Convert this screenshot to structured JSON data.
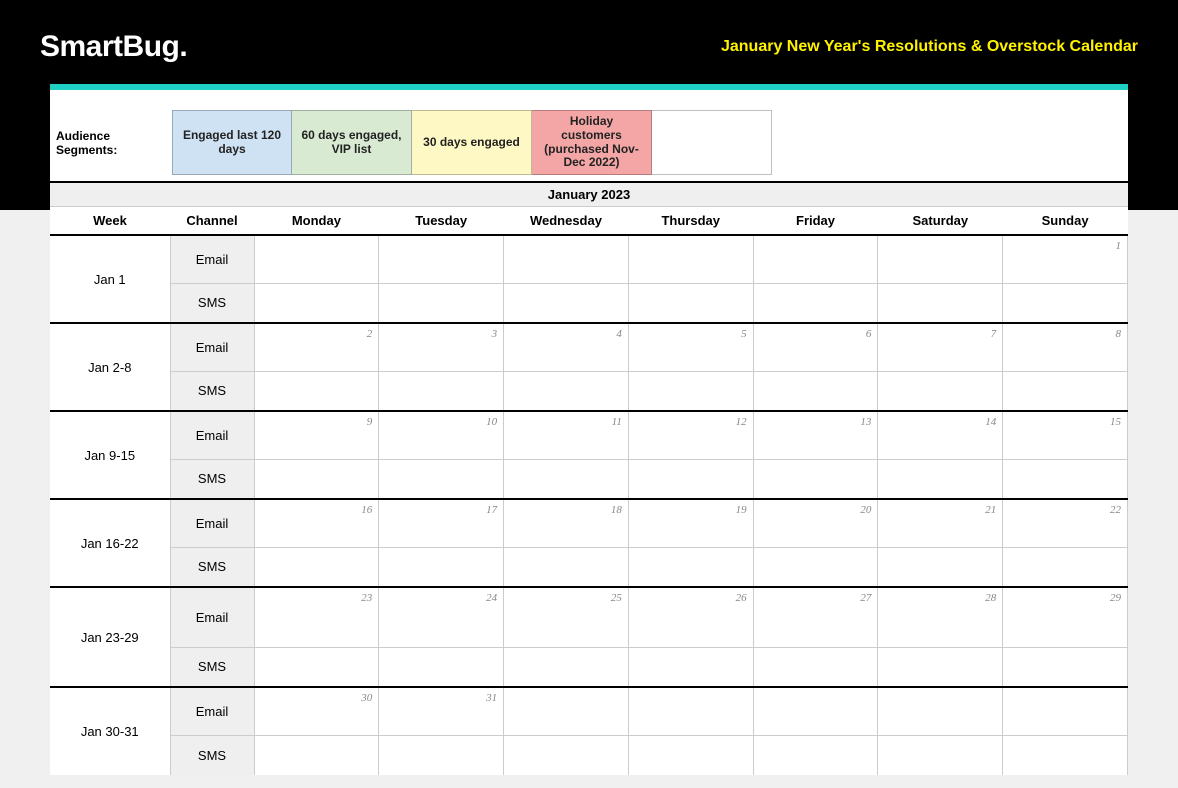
{
  "header": {
    "logo": "SmartBug.",
    "title": "January New Year's Resolutions & Overstock Calendar"
  },
  "segments": {
    "label": "Audience Segments:",
    "items": [
      {
        "text": "Engaged last 120 days",
        "class": "seg-blue"
      },
      {
        "text": "60 days engaged, VIP list",
        "class": "seg-green"
      },
      {
        "text": "30 days engaged",
        "class": "seg-yellow"
      },
      {
        "text": "Holiday customers (purchased Nov-Dec 2022)",
        "class": "seg-red"
      },
      {
        "text": "",
        "class": "seg-empty"
      }
    ]
  },
  "month": "January 2023",
  "columns": {
    "week": "Week",
    "channel": "Channel",
    "days": [
      "Monday",
      "Tuesday",
      "Wednesday",
      "Thursday",
      "Friday",
      "Saturday",
      "Sunday"
    ]
  },
  "channels": {
    "email": "Email",
    "sms": "SMS"
  },
  "weeks": [
    {
      "label": "Jan 1",
      "days": [
        "",
        "",
        "",
        "",
        "",
        "",
        "1"
      ]
    },
    {
      "label": "Jan 2-8",
      "days": [
        "2",
        "3",
        "4",
        "5",
        "6",
        "7",
        "8"
      ]
    },
    {
      "label": "Jan 9-15",
      "days": [
        "9",
        "10",
        "11",
        "12",
        "13",
        "14",
        "15"
      ]
    },
    {
      "label": "Jan 16-22",
      "days": [
        "16",
        "17",
        "18",
        "19",
        "20",
        "21",
        "22"
      ]
    },
    {
      "label": "Jan 23-29",
      "days": [
        "23",
        "24",
        "25",
        "26",
        "27",
        "28",
        "29"
      ]
    },
    {
      "label": "Jan 30-31",
      "days": [
        "30",
        "31",
        "",
        "",
        "",
        "",
        ""
      ]
    }
  ]
}
